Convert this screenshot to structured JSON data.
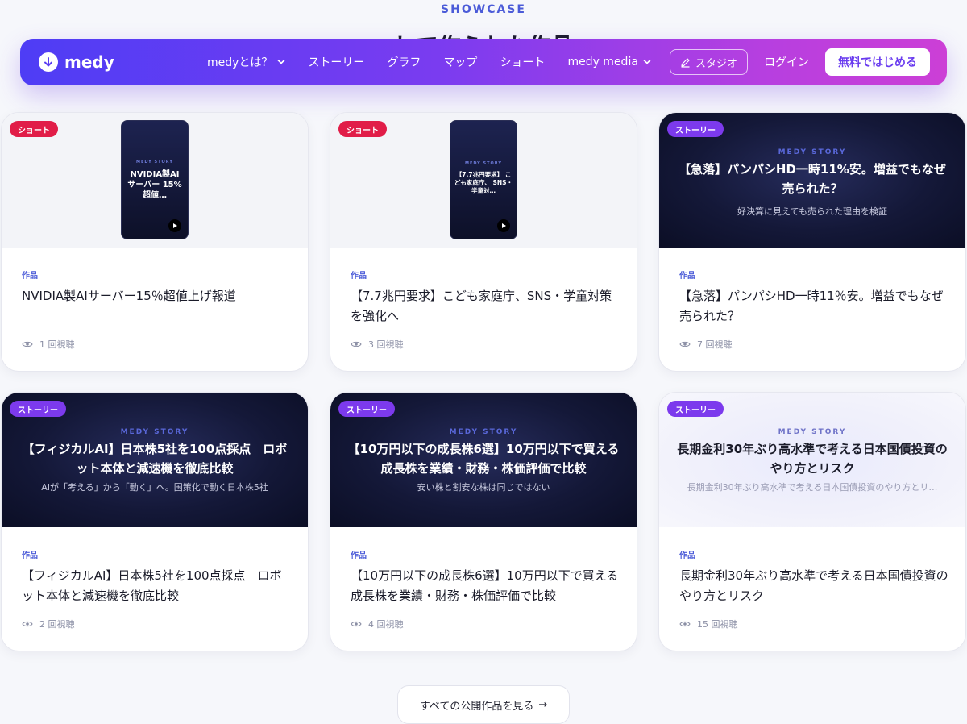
{
  "section": {
    "eyebrow": "SHOWCASE",
    "title": "して作られた作品"
  },
  "navbar": {
    "brand": "medy",
    "links": [
      {
        "label": "medyとは？",
        "dropdown": true
      },
      {
        "label": "ストーリー",
        "dropdown": false
      },
      {
        "label": "グラフ",
        "dropdown": false
      },
      {
        "label": "マップ",
        "dropdown": false
      },
      {
        "label": "ショート",
        "dropdown": false
      },
      {
        "label": "medy media",
        "dropdown": true
      }
    ],
    "studio_label": "スタジオ",
    "login_label": "ログイン",
    "start_label": "無料ではじめる",
    "colors": {
      "gradient_start": "#4e3df5",
      "gradient_end": "#cc3fd6"
    }
  },
  "cards": [
    {
      "badge": "ショート",
      "phone_eyebrow": "MEDY STORY",
      "phone_title": "NVIDIA製AI サーバー 15%超値…",
      "label": "作品",
      "title": "NVIDIA製AIサーバー15％超値上げ報道",
      "views": "1 回視聴"
    },
    {
      "badge": "ショート",
      "phone_eyebrow": "MEDY STORY",
      "phone_title": "【7.7兆円要求】 こども家庭庁、 SNS・学童対…",
      "label": "作品",
      "title": "【7.7兆円要求】こども家庭庁、SNS・学童対策を強化へ",
      "views": "3 回視聴"
    },
    {
      "badge": "ストーリー",
      "story_eyebrow": "MEDY STORY",
      "story_title": "【急落】パンパシHD一時11%安。増益でもなぜ売られた？",
      "story_sub": "好決算に見えても売られた理由を検証",
      "label": "作品",
      "title": "【急落】パンパシHD一時11％安。増益でもなぜ売られた？",
      "views": "7 回視聴"
    },
    {
      "badge": "ストーリー",
      "story_eyebrow": "MEDY STORY",
      "story_title": "【フィジカルAI】日本株5社を100点採点　ロボット本体と減速機を徹底比較",
      "story_sub": "AIが「考える」から「動く」へ。国策化で動く日本株5社",
      "label": "作品",
      "title": "【フィジカルAI】日本株5社を100点採点　ロボット本体と減速機を徹底比較",
      "views": "2 回視聴"
    },
    {
      "badge": "ストーリー",
      "story_eyebrow": "MEDY STORY",
      "story_title": "【10万円以下の成長株6選】10万円以下で買える成長株を業績・財務・株価評価で比較",
      "story_sub": "安い株と割安な株は同じではない",
      "label": "作品",
      "title": "【10万円以下の成長株6選】10万円以下で買える成長株を業績・財務・株価評価で比較",
      "views": "4 回視聴"
    },
    {
      "badge": "ストーリー",
      "story_eyebrow": "MEDY STORY",
      "story_title": "長期金利30年ぶり高水準で考える日本国債投資のやり方とリスク",
      "story_sub": "長期金利30年ぶり高水準で考える日本国債投資のやり方とリ…",
      "label": "作品",
      "title": "長期金利30年ぶり高水準で考える日本国債投資のやり方とリスク",
      "views": "15 回視聴"
    }
  ],
  "all_works_button": {
    "label": "すべての公開作品を見る",
    "arrow": "→"
  }
}
